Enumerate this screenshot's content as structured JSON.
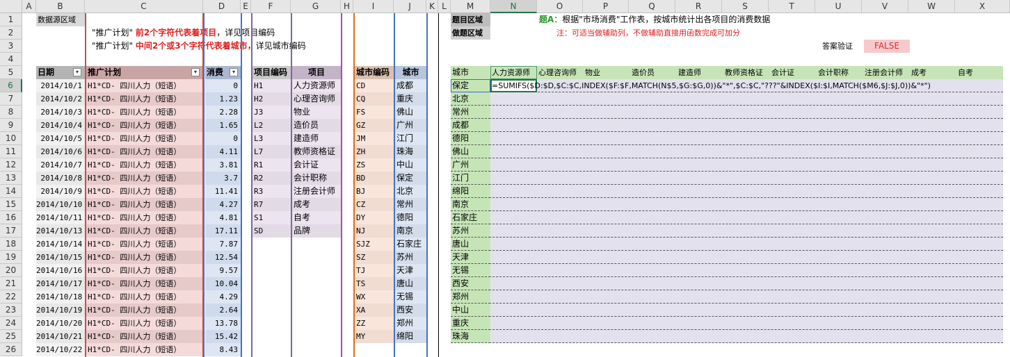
{
  "columns": [
    "A",
    "B",
    "C",
    "D",
    "E",
    "F",
    "G",
    "H",
    "I",
    "J",
    "K",
    "L",
    "M",
    "N",
    "O",
    "P",
    "Q",
    "R",
    "S",
    "T",
    "U",
    "V",
    "W",
    "X"
  ],
  "rows": [
    "1",
    "2",
    "3",
    "4",
    "5",
    "6",
    "7",
    "8",
    "9",
    "10",
    "11",
    "12",
    "13",
    "14",
    "15",
    "16",
    "17",
    "18",
    "19",
    "20",
    "21",
    "22",
    "23",
    "24",
    "25",
    "26"
  ],
  "labels": {
    "data_area": "数据源区域",
    "question_area": "题目区域",
    "answer_area": "做题区域",
    "answer_check": "答案验证",
    "answer_value": "FALSE"
  },
  "notes": {
    "line1_prefix": "\"推广计划\"",
    "line1_red": "前2个字符代表着项目",
    "line1_suffix": "，详见项目编码",
    "line2_prefix": "\"推广计划\"",
    "line2_red": "中间2个或3个字符代表着城市",
    "line2_suffix": "，详见城市编码",
    "task_bold": "题A：",
    "task": "根据\"市场消费\"工作表，按城市统计出各项目的消费数据",
    "tip": "注：可适当做辅助列，不做辅助直接用函数完成可加分"
  },
  "table1": {
    "headers": [
      "日期",
      "推广计划",
      "消费"
    ],
    "rows": [
      [
        "2014/10/1",
        "H1*CD- 四川人力（短语）",
        "0"
      ],
      [
        "2014/10/2",
        "H1*CD- 四川人力（短语）",
        "1.23"
      ],
      [
        "2014/10/3",
        "H1*CD- 四川人力（短语）",
        "2.28"
      ],
      [
        "2014/10/4",
        "H1*CD- 四川人力（短语）",
        "1.65"
      ],
      [
        "2014/10/5",
        "H1*CD- 四川人力（短语）",
        "0"
      ],
      [
        "2014/10/6",
        "H1*CD- 四川人力（短语）",
        "4.11"
      ],
      [
        "2014/10/7",
        "H1*CD- 四川人力（短语）",
        "3.81"
      ],
      [
        "2014/10/8",
        "H1*CD- 四川人力（短语）",
        "3.7"
      ],
      [
        "2014/10/9",
        "H1*CD- 四川人力（短语）",
        "11.41"
      ],
      [
        "2014/10/10",
        "H1*CD- 四川人力（短语）",
        "4.27"
      ],
      [
        "2014/10/11",
        "H1*CD- 四川人力（短语）",
        "4.81"
      ],
      [
        "2014/10/13",
        "H1*CD- 四川人力（短语）",
        "17.11"
      ],
      [
        "2014/10/14",
        "H1*CD- 四川人力（短语）",
        "7.87"
      ],
      [
        "2014/10/15",
        "H1*CD- 四川人力（短语）",
        "12.54"
      ],
      [
        "2014/10/16",
        "H1*CD- 四川人力（短语）",
        "9.57"
      ],
      [
        "2014/10/17",
        "H1*CD- 四川人力（短语）",
        "10.04"
      ],
      [
        "2014/10/18",
        "H1*CD- 四川人力（短语）",
        "4.29"
      ],
      [
        "2014/10/19",
        "H1*CD- 四川人力（短语）",
        "2.64"
      ],
      [
        "2014/10/20",
        "H1*CD- 四川人力（短语）",
        "13.78"
      ],
      [
        "2014/10/21",
        "H1*CD- 四川人力（短语）",
        "15.42"
      ],
      [
        "2014/10/22",
        "H1*CD- 四川人力（短语）",
        "8.43"
      ]
    ]
  },
  "table2": {
    "headers": [
      "项目编码",
      "项目"
    ],
    "rows": [
      [
        "H1",
        "人力资源师"
      ],
      [
        "H2",
        "心理咨询师"
      ],
      [
        "J3",
        "物业"
      ],
      [
        "L2",
        "造价员"
      ],
      [
        "L3",
        "建造师"
      ],
      [
        "L7",
        "教师资格证"
      ],
      [
        "R1",
        "会计证"
      ],
      [
        "R2",
        "会计职称"
      ],
      [
        "R3",
        "注册会计师"
      ],
      [
        "R7",
        "成考"
      ],
      [
        "S1",
        "自考"
      ],
      [
        "SD",
        "品牌"
      ]
    ]
  },
  "table3": {
    "headers": [
      "城市编码",
      "城市"
    ],
    "rows": [
      [
        "CD",
        "成都"
      ],
      [
        "CQ",
        "重庆"
      ],
      [
        "FS",
        "佛山"
      ],
      [
        "GZ",
        "广州"
      ],
      [
        "JM",
        "江门"
      ],
      [
        "ZH",
        "珠海"
      ],
      [
        "ZS",
        "中山"
      ],
      [
        "BD",
        "保定"
      ],
      [
        "BJ",
        "北京"
      ],
      [
        "CZ",
        "常州"
      ],
      [
        "DY",
        "德阳"
      ],
      [
        "NJ",
        "南京"
      ],
      [
        "SJZ",
        "石家庄"
      ],
      [
        "SZ",
        "苏州"
      ],
      [
        "TJ",
        "天津"
      ],
      [
        "TS",
        "唐山"
      ],
      [
        "WX",
        "无锡"
      ],
      [
        "XA",
        "西安"
      ],
      [
        "ZZ",
        "郑州"
      ],
      [
        "MY",
        "绵阳"
      ]
    ]
  },
  "answer": {
    "corner": "城市",
    "headers": [
      "人力资源师",
      "心理咨询师",
      "物业",
      "造价员",
      "建造师",
      "教师资格证",
      "会计证",
      "会计职称",
      "注册会计师",
      "成考",
      "自考"
    ],
    "cities": [
      "保定",
      "北京",
      "常州",
      "成都",
      "德阳",
      "佛山",
      "广州",
      "江门",
      "绵阳",
      "南京",
      "石家庄",
      "苏州",
      "唐山",
      "天津",
      "无锡",
      "西安",
      "郑州",
      "中山",
      "重庆",
      "珠海"
    ],
    "formula": "=SUMIFS($D:$D,$C:$C,INDEX($F:$F,MATCH(N$5,$G:$G,0))&\"*\",$C:$C,\"???\"&INDEX($I:$I,MATCH($M6,$J:$J,0))&\"*\")"
  }
}
